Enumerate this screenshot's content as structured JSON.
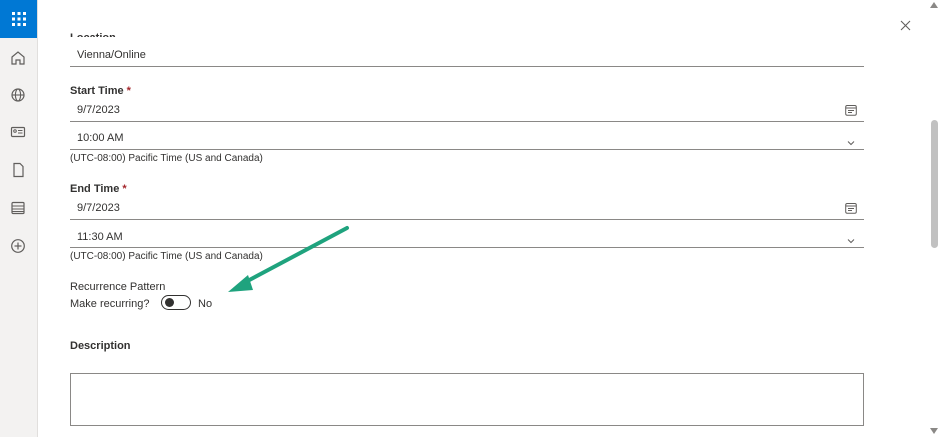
{
  "form": {
    "location_label": "Location",
    "location_value": "Vienna/Online",
    "start_time_label": "Start Time",
    "start_date": "9/7/2023",
    "start_time": "10:00 AM",
    "start_timezone": "(UTC-08:00) Pacific Time (US and Canada)",
    "end_time_label": "End Time",
    "end_date": "9/7/2023",
    "end_time": "11:30 AM",
    "end_timezone": "(UTC-08:00) Pacific Time (US and Canada)",
    "required_marker": "*",
    "recurrence_label": "Recurrence Pattern",
    "make_recurring_label": "Make recurring?",
    "make_recurring_value": "No",
    "description_label": "Description",
    "description_value": ""
  },
  "rail": {
    "items": [
      "app-launcher-icon",
      "home-icon",
      "globe-icon",
      "contact-card-icon",
      "document-icon",
      "list-icon",
      "add-icon"
    ]
  },
  "colors": {
    "accent": "#0078d4",
    "annotation_arrow": "#1fa37e",
    "required": "#a4262c"
  }
}
